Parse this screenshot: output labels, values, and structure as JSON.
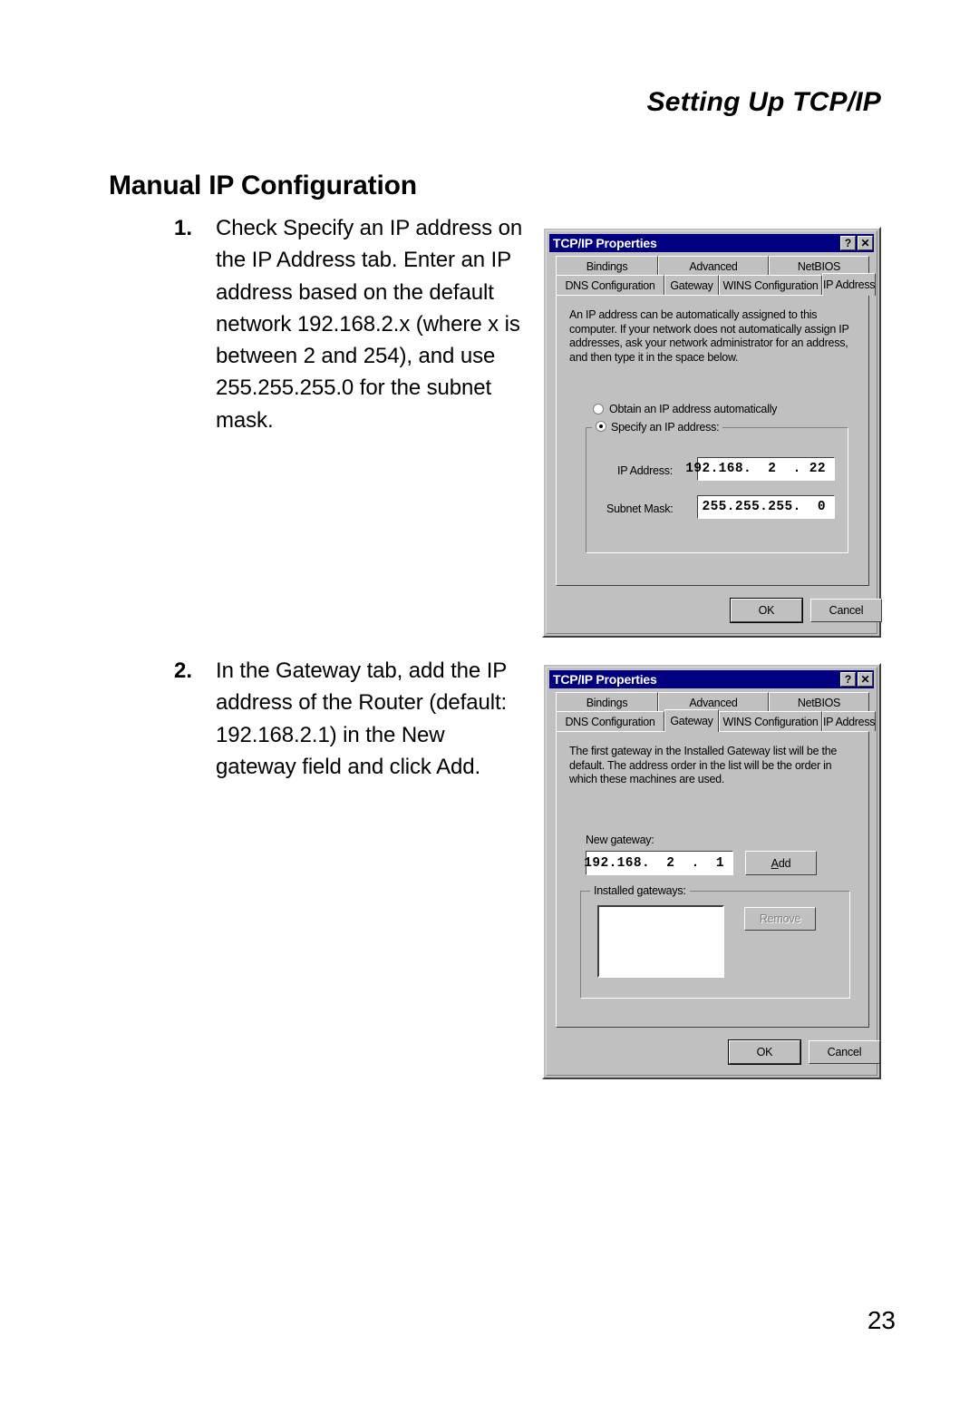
{
  "page": {
    "running_header": "Setting Up TCP/IP",
    "section_title": "Manual IP Configuration",
    "page_number": "23"
  },
  "steps": [
    {
      "number": "1.",
      "text": "Check Specify an IP address on the IP Address tab. Enter an IP address based on the default network 192.168.2.x (where x is between 2 and 254), and use 255.255.255.0 for the subnet mask."
    },
    {
      "number": "2.",
      "text": "In the Gateway tab, add the IP address of the Router (default: 192.168.2.1) in the New gateway field and click Add."
    }
  ],
  "dialog_ip": {
    "title": "TCP/IP Properties",
    "help_button": "?",
    "close_button": "✕",
    "tabs_top": [
      "Bindings",
      "Advanced",
      "NetBIOS"
    ],
    "tabs_bottom": [
      "DNS Configuration",
      "Gateway",
      "WINS Configuration",
      "IP Address"
    ],
    "selected_tab": "IP Address",
    "description": "An IP address can be automatically assigned to this computer. If your network does not automatically assign IP addresses, ask your network administrator for an address, and then type it in the space below.",
    "radio_obtain": "Obtain an IP address automatically",
    "radio_obtain_checked": "false",
    "radio_specify": "Specify an IP address:",
    "radio_specify_checked": "true",
    "ip_address_label": "IP Address:",
    "ip_address_value": "192.168.  2  . 22",
    "subnet_mask_label": "Subnet Mask:",
    "subnet_mask_value": "255.255.255.  0",
    "ok_label": "OK",
    "cancel_label": "Cancel"
  },
  "dialog_gateway": {
    "title": "TCP/IP Properties",
    "help_button": "?",
    "close_button": "✕",
    "tabs_top": [
      "Bindings",
      "Advanced",
      "NetBIOS"
    ],
    "tabs_bottom": [
      "DNS Configuration",
      "Gateway",
      "WINS Configuration",
      "IP Address"
    ],
    "selected_tab": "Gateway",
    "description": "The first gateway in the Installed Gateway list will be the default. The address order in the list will be the order in which these machines are used.",
    "new_gateway_label": "New gateway:",
    "new_gateway_value": "192.168.  2  .  1",
    "add_label": "Add",
    "installed_gateways_label": "Installed gateways:",
    "installed_gateways_items": [],
    "remove_label": "Remove",
    "remove_disabled": "true",
    "ok_label": "OK",
    "cancel_label": "Cancel"
  },
  "colors": {
    "titlebar": "#000080",
    "dialog_face": "#c0c0c0",
    "field_background": "#ffffff",
    "page_background": "#ffffff"
  }
}
